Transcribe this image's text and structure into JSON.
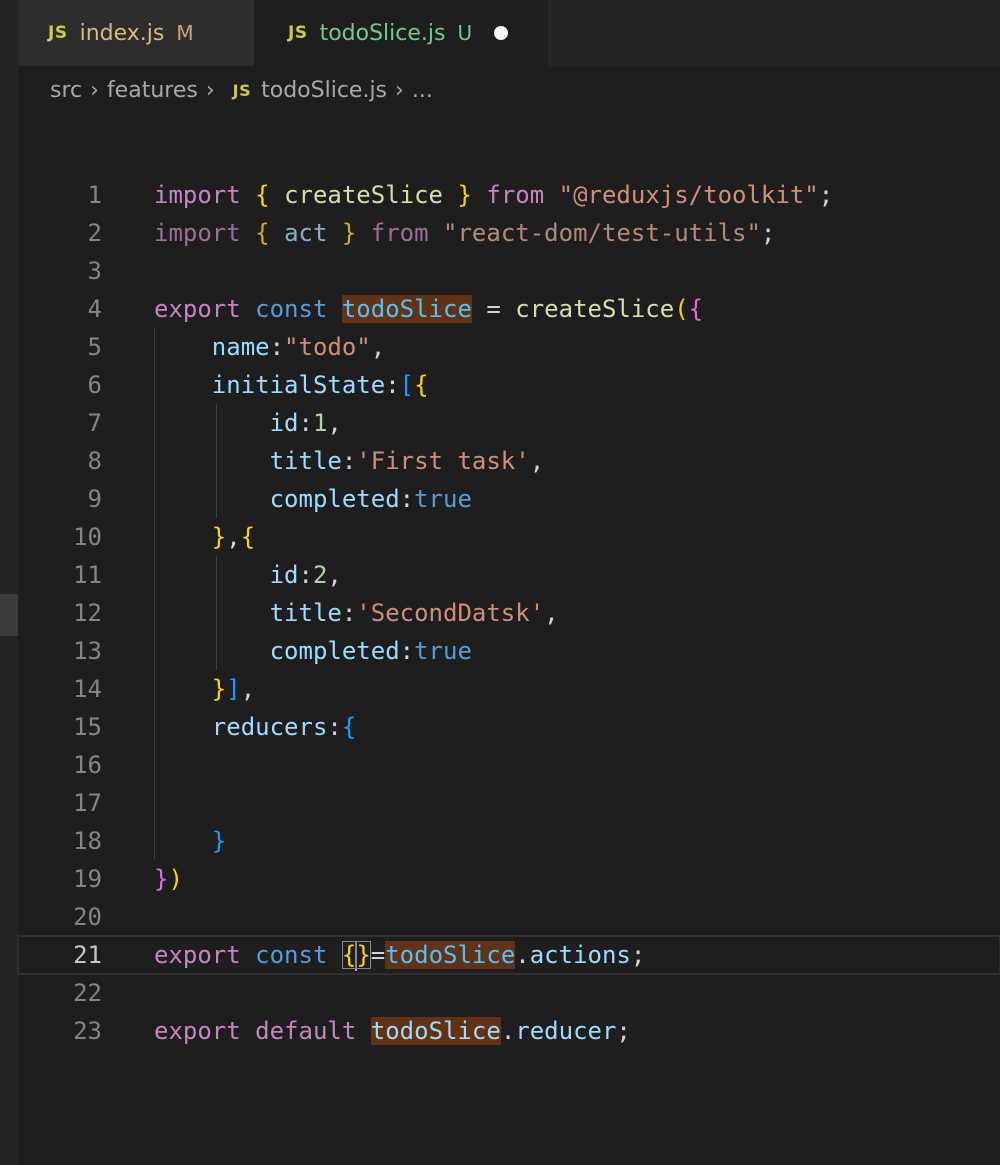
{
  "tabs": [
    {
      "icon": "JS",
      "name": "index.js",
      "status": "M"
    },
    {
      "icon": "JS",
      "name": "todoSlice.js",
      "status": "U"
    }
  ],
  "breadcrumb": {
    "part1": "src",
    "part2": "features",
    "file_icon": "JS",
    "file": "todoSlice.js",
    "more": "..."
  },
  "editor": {
    "current_line": 21,
    "line_numbers": [
      "1",
      "2",
      "3",
      "4",
      "5",
      "6",
      "7",
      "8",
      "9",
      "10",
      "11",
      "12",
      "13",
      "14",
      "15",
      "16",
      "17",
      "18",
      "19",
      "20",
      "21",
      "22",
      "23"
    ],
    "lines": [
      "import { createSlice } from \"@reduxjs/toolkit\";",
      "import { act } from \"react-dom/test-utils\";",
      "",
      "export const todoSlice = createSlice({",
      "    name:\"todo\",",
      "    initialState:[{",
      "        id:1,",
      "        title:'First task',",
      "        completed:true",
      "    },{",
      "        id:2,",
      "        title:'SecondDatsk',",
      "        completed:true",
      "    }],",
      "    reducers:{",
      "",
      "",
      "    }",
      "})",
      "",
      "export const {}=todoSlice.actions;",
      "",
      "export default todoSlice.reducer;"
    ]
  },
  "colors": {
    "keyword": "#c586c0",
    "string": "#ce9178",
    "function": "#dcdcaa",
    "variable": "#9cdcfe",
    "constant": "#569cd6",
    "word_highlight": "#613214",
    "background": "#1e1e1e"
  }
}
